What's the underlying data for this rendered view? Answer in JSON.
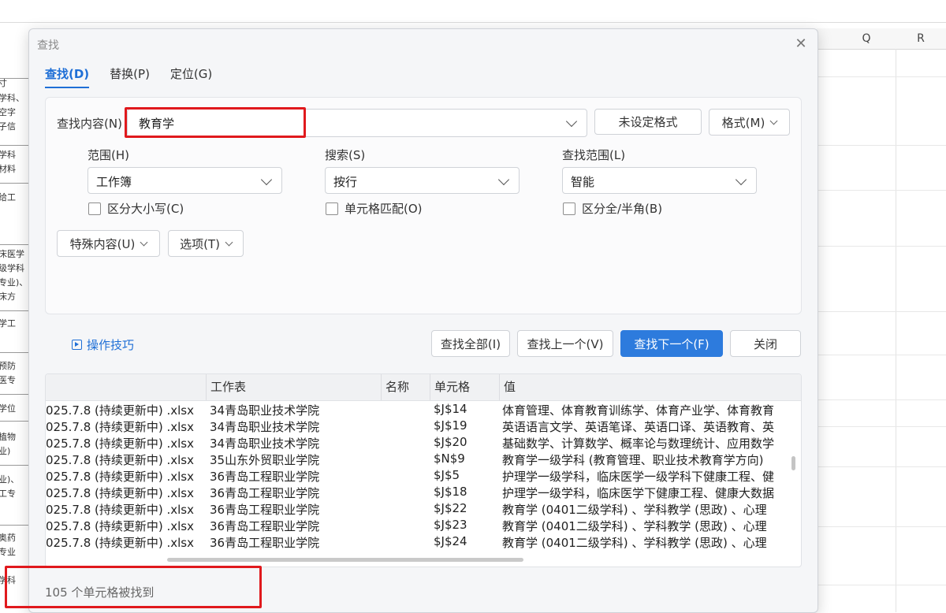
{
  "sheet": {
    "columns": [
      "Q",
      "R"
    ],
    "left_fragments": [
      "寸",
      "学科、",
      "空字",
      "子信",
      "学科",
      "材料",
      "给工",
      "床医学",
      "级学科",
      "专业)、",
      "床方",
      "学工",
      "预防",
      "医专",
      "学位",
      "植物",
      "业)",
      "业)、",
      "工专",
      "奥药",
      "专业",
      "学科"
    ]
  },
  "dialog": {
    "title": "查找",
    "close_icon": "close-icon",
    "tabs": [
      {
        "label": "查找(D)",
        "active": true
      },
      {
        "label": "替换(P)",
        "active": false
      },
      {
        "label": "定位(G)",
        "active": false
      }
    ],
    "find": {
      "label": "查找内容(N)",
      "value": "教育学",
      "format_status": "未设定格式",
      "format_button": "格式(M)"
    },
    "scope": {
      "label": "范围(H)",
      "value": "工作簿"
    },
    "search": {
      "label": "搜索(S)",
      "value": "按行"
    },
    "look_in": {
      "label": "查找范围(L)",
      "value": "智能"
    },
    "options": {
      "match_case": "区分大小写(C)",
      "match_cell": "单元格匹配(O)",
      "match_width": "区分全/半角(B)"
    },
    "special_button": "特殊内容(U)",
    "options_button": "选项(T)",
    "tips_link": "操作技巧",
    "buttons": {
      "find_all": "查找全部(I)",
      "find_prev": "查找上一个(V)",
      "find_next": "查找下一个(F)",
      "close": "关闭"
    },
    "results": {
      "headers": [
        "",
        "工作表",
        "名称",
        "单元格",
        "值"
      ],
      "rows": [
        {
          "book": "025.7.8 (持续更新中) .xlsx",
          "sheet": "34青岛职业技术学院",
          "name": "",
          "cell": "$J$14",
          "value": "体育管理、体育教育训练学、体育产业学、体育教育"
        },
        {
          "book": "025.7.8 (持续更新中) .xlsx",
          "sheet": "34青岛职业技术学院",
          "name": "",
          "cell": "$J$19",
          "value": "英语语言文学、英语笔译、英语口译、英语教育、英"
        },
        {
          "book": "025.7.8 (持续更新中) .xlsx",
          "sheet": "34青岛职业技术学院",
          "name": "",
          "cell": "$J$20",
          "value": "基础数学、计算数学、概率论与数理统计、应用数学"
        },
        {
          "book": "025.7.8 (持续更新中) .xlsx",
          "sheet": "35山东外贸职业学院",
          "name": "",
          "cell": "$N$9",
          "value": "教育学一级学科 (教育管理、职业技术教育学方向)"
        },
        {
          "book": "025.7.8 (持续更新中) .xlsx",
          "sheet": "36青岛工程职业学院",
          "name": "",
          "cell": "$J$5",
          "value": "护理学一级学科，临床医学一级学科下健康工程、健"
        },
        {
          "book": "025.7.8 (持续更新中) .xlsx",
          "sheet": "36青岛工程职业学院",
          "name": "",
          "cell": "$J$18",
          "value": "护理学一级学科，临床医学下健康工程、健康大数据"
        },
        {
          "book": "025.7.8 (持续更新中) .xlsx",
          "sheet": "36青岛工程职业学院",
          "name": "",
          "cell": "$J$22",
          "value": "教育学 (0401二级学科) 、学科教学 (思政) 、心理"
        },
        {
          "book": "025.7.8 (持续更新中) .xlsx",
          "sheet": "36青岛工程职业学院",
          "name": "",
          "cell": "$J$23",
          "value": "教育学 (0401二级学科) 、学科教学 (思政) 、心理"
        },
        {
          "book": "025.7.8 (持续更新中) .xlsx",
          "sheet": "36青岛工程职业学院",
          "name": "",
          "cell": "$J$24",
          "value": "教育学 (0401二级学科) 、学科教学 (思政) 、心理"
        }
      ]
    },
    "status": "105 个单元格被找到"
  },
  "colors": {
    "accent": "#2d7bdd",
    "highlight_box": "#e0191d",
    "link": "#1f6fd6"
  }
}
